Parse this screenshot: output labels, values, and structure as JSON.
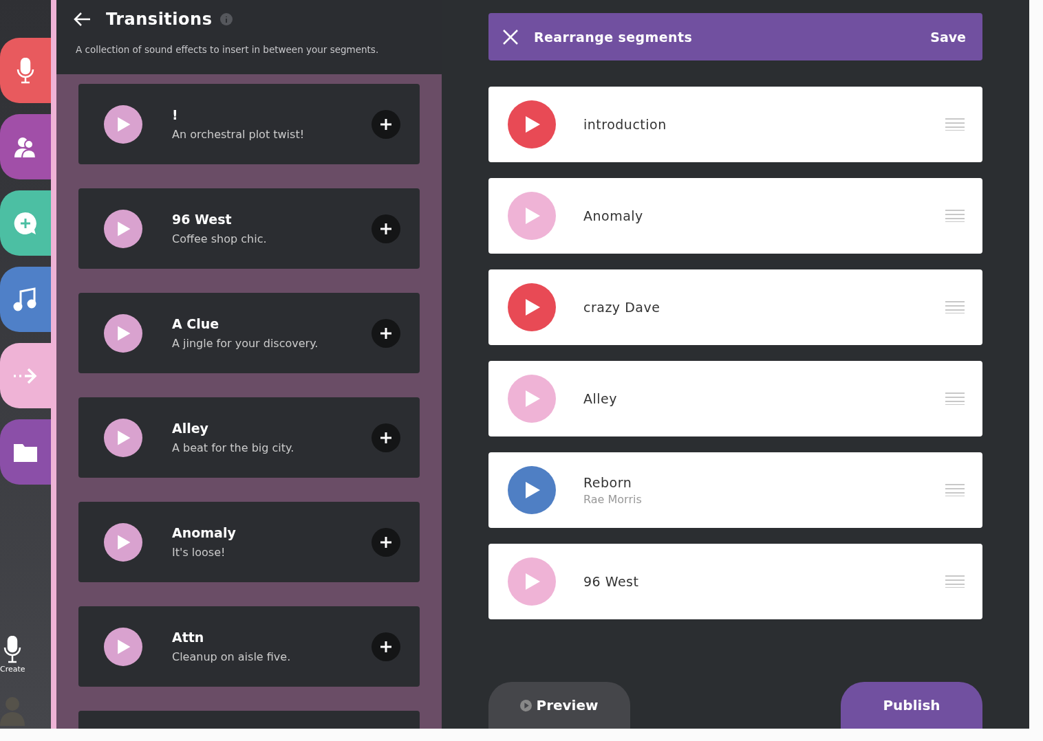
{
  "nav": {
    "items": [
      {
        "color": "#e85a5e"
      },
      {
        "color": "#a14fa8"
      },
      {
        "color": "#4cbfa3"
      },
      {
        "color": "#4f80c8"
      },
      {
        "color": "#efb3d6"
      },
      {
        "color": "#8b4fa8"
      }
    ],
    "create_label": "Create"
  },
  "transitions": {
    "title": "Transitions",
    "description": "A collection of sound effects to insert in between your segments.",
    "items": [
      {
        "name": "!",
        "description": "An orchestral plot twist!"
      },
      {
        "name": "96 West",
        "description": "Coffee shop chic."
      },
      {
        "name": "A Clue",
        "description": "A jingle for your discovery."
      },
      {
        "name": "Alley",
        "description": "A beat for the big city."
      },
      {
        "name": "Anomaly",
        "description": "It's loose!"
      },
      {
        "name": "Attn",
        "description": "Cleanup on aisle five."
      }
    ]
  },
  "rearrange": {
    "title": "Rearrange segments",
    "save": "Save",
    "segments": [
      {
        "name": "introduction",
        "color": "#e84a55"
      },
      {
        "name": "Anomaly",
        "color": "#efb3d6"
      },
      {
        "name": "crazy Dave",
        "color": "#e84a55"
      },
      {
        "name": "Alley",
        "color": "#efb3d6"
      },
      {
        "name": "Reborn",
        "artist": "Rae Morris",
        "color": "#4f7fc4"
      },
      {
        "name": "96 West",
        "color": "#efb3d6"
      }
    ],
    "preview": "Preview",
    "publish": "Publish"
  }
}
